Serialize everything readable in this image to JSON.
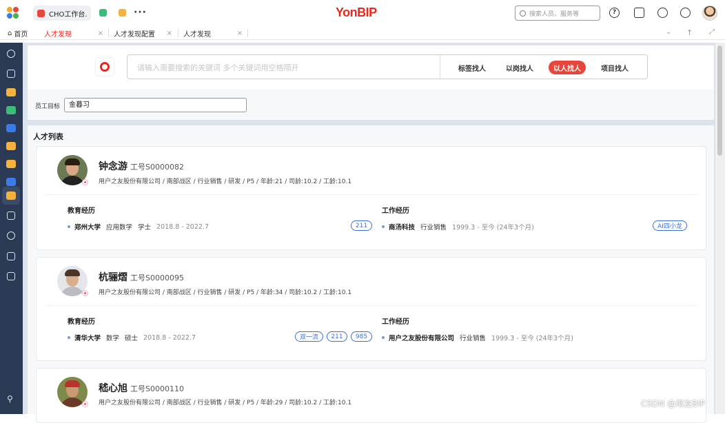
{
  "topbar": {
    "app_tab_label": "CHO工作台.",
    "brand": "YonBIP",
    "search_placeholder": "搜索人员、服务等"
  },
  "page_tabs": [
    {
      "label": "首页"
    },
    {
      "label": "人才发现",
      "active": true
    },
    {
      "label": "人才发现配置"
    },
    {
      "label": "人才发现"
    }
  ],
  "search": {
    "placeholder": "请输入需要搜索的关键词 多个关键词用空格隔开",
    "modes": [
      {
        "label": "标签找人",
        "active": false
      },
      {
        "label": "以岗找人",
        "active": false
      },
      {
        "label": "以人找人",
        "active": true
      },
      {
        "label": "项目找人",
        "active": false
      }
    ]
  },
  "filter": {
    "label": "员工目标",
    "value": "金暮习"
  },
  "list": {
    "title": "人才列表",
    "edu_title": "教育经历",
    "work_title": "工作经历",
    "cards": [
      {
        "name": "钟念游",
        "emp_no": "工号S0000082",
        "meta": "用户之友股份有限公司 / 南部战区 / 行业销售 / 研发 / P5 / 年龄:21 / 司龄:10.2 / 工龄:10.1",
        "edu": {
          "school": "郑州大学",
          "major": "应用数学",
          "degree": "学士",
          "date": "2018.8 - 2022.7",
          "tags": [
            "211"
          ]
        },
        "work": {
          "company": "商汤科技",
          "dept": "行业销售",
          "date": "1999.3 - 至今 (24年3个月)",
          "tags": [
            "AI四小龙"
          ]
        }
      },
      {
        "name": "杭骊熠",
        "emp_no": "工号S0000095",
        "meta": "用户之友股份有限公司 / 南部战区 / 行业销售 / 研发 / P5 / 年龄:34 / 司龄:10.2 / 工龄:10.1",
        "edu": {
          "school": "清华大学",
          "major": "数学",
          "degree": "硕士",
          "date": "2018.8 - 2022.7",
          "tags": [
            "双一流",
            "211",
            "985"
          ]
        },
        "work": {
          "company": "用户之友股份有限公司",
          "dept": "行业销售",
          "date": "1999.3 - 至今 (24年3个月)",
          "tags": []
        }
      },
      {
        "name": "嵇心旭",
        "emp_no": "工号S0000110",
        "meta": "用户之友股份有限公司 / 南部战区 / 行业销售 / 研发 / P5 / 年龄:29 / 司龄:10.2 / 工龄:10.1"
      }
    ]
  },
  "watermark": "CSDN @用友BIP"
}
